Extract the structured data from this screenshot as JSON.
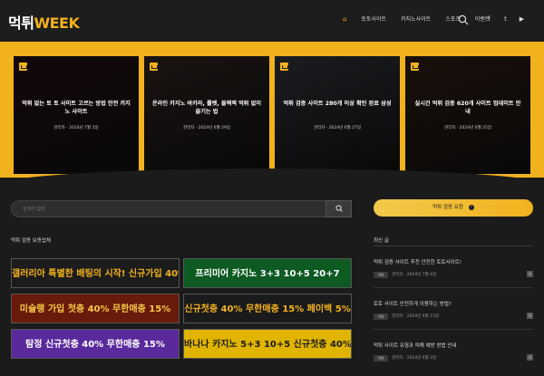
{
  "brand": {
    "logo_main": "먹튀",
    "logo_accent": "WEEK",
    "accent_color": "#f2b21e"
  },
  "nav": {
    "home_glyph": "⌂",
    "items": [
      "토토사이트",
      "카지노사이트",
      "스포츠",
      "이벤트"
    ]
  },
  "social": [
    "f",
    "t",
    "▶"
  ],
  "featured": [
    {
      "title": "먹튀 없는 토 토 사이트 고르는 방법 안전 카지노 사이트",
      "meta": "관리자 · 2024년 7월 2일",
      "bg": "#2b1214"
    },
    {
      "title": "온라인 카지노 바카라, 룰렛, 블랙잭 먹튀 없이 즐기는 법",
      "meta": "관리자 · 2024년 6월 29일",
      "bg": "#3a2c28"
    },
    {
      "title": "먹튀 검증 사이트 280개 이상 확인 완료 삼성",
      "meta": "관리자 · 2024년 6월 27일",
      "bg": "#3c3f47"
    },
    {
      "title": "실시간 먹튀 검증 620개 사이트 업데이트 안내",
      "meta": "관리자 · 2024년 6월 25일",
      "bg": "#3a2418"
    }
  ],
  "search": {
    "placeholder": "검색어 입력"
  },
  "partners_title": "먹튀 검증 보증업체",
  "banners": [
    {
      "text": "갤러리아 특별한 배팅의 시작! 신규가입 40%",
      "bg": "#1c1c1c",
      "fg": "#f2b21e"
    },
    {
      "text": "프리미어 카지노 3+3 10+5 20+7",
      "bg": "#0d5a23",
      "fg": "#ffffff"
    },
    {
      "text": "미슐랭 가입 첫충 40% 무한매충 15%",
      "bg": "#6a1a0a",
      "fg": "#f7c948"
    },
    {
      "text": "신규첫충 40% 무한매충 15% 페이백 5%",
      "bg": "#1a1a1a",
      "fg": "#f2b21e"
    },
    {
      "text": "탐정 신규첫충 40% 무한매충 15%",
      "bg": "#5a2a9c",
      "fg": "#ffffff"
    },
    {
      "text": "바나나 카지노 5+3 10+5 신규첫충 40%",
      "bg": "#e0b400",
      "fg": "#1d1d1d"
    }
  ],
  "cta": {
    "label": "먹튀 검증 요청",
    "info": "i"
  },
  "latest": {
    "title": "최신 글",
    "posts": [
      {
        "title": "먹튀 검증 사이트 추천 안전한 토토사이트!",
        "tag": "먹튀",
        "meta": "관리자 · 2024년 7월 4일",
        "count": "0"
      },
      {
        "title": "토토 사이트 안전하게 이용하는 방법?",
        "tag": "먹튀",
        "meta": "관리자 · 2024년 6월 15일",
        "count": "0"
      },
      {
        "title": "먹튀 사이트 유형과 피해 예방 방법 안내",
        "tag": "먹튀",
        "meta": "관리자 · 2024년 6월 3일",
        "count": "0"
      }
    ]
  }
}
